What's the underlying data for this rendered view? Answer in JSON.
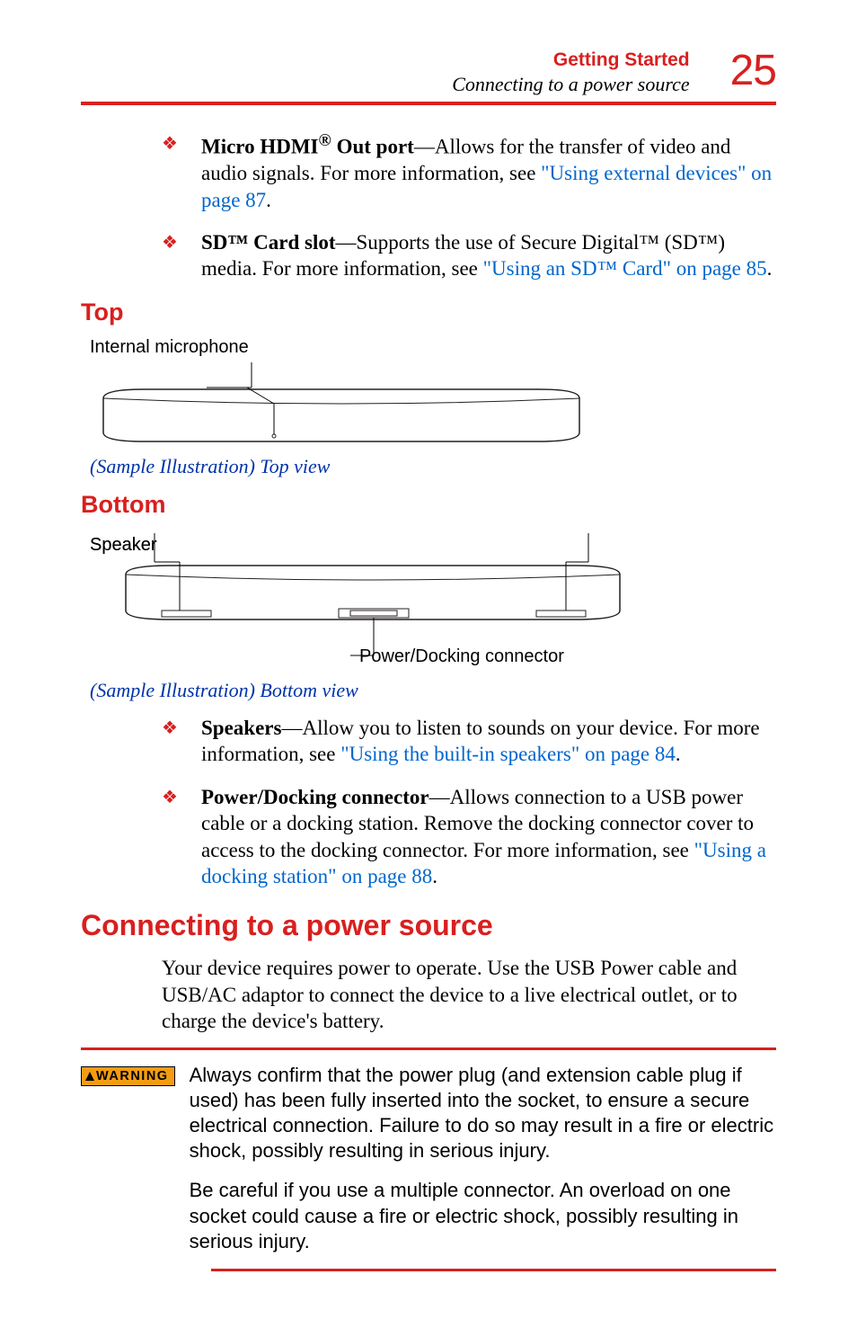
{
  "page_number": "25",
  "header": {
    "title": "Getting Started",
    "subtitle": "Connecting to a power source"
  },
  "bullets_top": [
    {
      "bold": "Micro HDMI",
      "sup": "®",
      "bold2": " Out port",
      "rest": "—Allows for the transfer of video and audio signals. For more information, see ",
      "link": "\"Using external devices\" on page 87",
      "tail": "."
    },
    {
      "bold": "SD™ Card slot",
      "rest": "—Supports the use of Secure Digital™ (SD™) media. For more information, see ",
      "link": "\"Using an SD™ Card\" on page 85",
      "tail": "."
    }
  ],
  "section_top": "Top",
  "callouts": {
    "internal_mic": "Internal microphone",
    "speaker": "Speaker",
    "power_dock": "Power/Docking connector"
  },
  "caption_top": "(Sample Illustration) Top view",
  "section_bottom": "Bottom",
  "caption_bottom": "(Sample Illustration) Bottom view",
  "bullets_bottom": [
    {
      "bold": "Speakers",
      "rest": "—Allow you to listen to sounds on your device. For more information, see ",
      "link": "\"Using the built-in speakers\" on page 84",
      "tail": "."
    },
    {
      "bold": "Power/Docking connector",
      "rest": "—Allows connection to a USB power cable or a docking station. Remove the docking connector cover to access to the docking connector. For more information, see ",
      "link": "\"Using a docking station\" on page 88",
      "tail": "."
    }
  ],
  "section_power": "Connecting to a power source",
  "power_para": "Your device requires power to operate. Use the USB Power cable and USB/AC adaptor to connect the device to a live electrical outlet, or to charge the device's battery.",
  "warning_label": "WARNING",
  "warning_p1": "Always confirm that the power plug (and extension cable plug if used) has been fully inserted into the socket, to ensure a secure electrical connection. Failure to do so may result in a fire or electric shock, possibly resulting in serious injury.",
  "warning_p2": "Be careful if you use a multiple connector. An overload on one socket could cause a fire or electric shock, possibly resulting in serious injury."
}
